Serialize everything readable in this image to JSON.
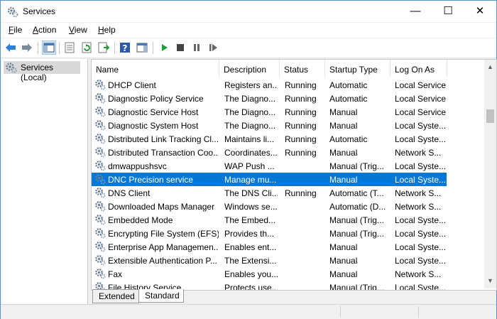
{
  "window": {
    "title": "Services"
  },
  "window_controls": {
    "minimize": "—",
    "maximize": "☐",
    "close": "✕"
  },
  "menu": [
    {
      "label": "File",
      "accel": "F",
      "rest": "ile"
    },
    {
      "label": "Action",
      "accel": "A",
      "rest": "ction"
    },
    {
      "label": "View",
      "accel": "V",
      "rest": "iew"
    },
    {
      "label": "Help",
      "accel": "H",
      "rest": "elp"
    }
  ],
  "toolbar": {
    "icons": [
      "back-arrow-icon",
      "forward-arrow-icon",
      "show-hide-console-tree-icon",
      "properties-icon",
      "refresh-icon",
      "export-list-icon",
      "help-icon",
      "show-hide-action-pane-icon",
      "start-service-icon",
      "stop-service-icon",
      "pause-service-icon",
      "resume-service-icon"
    ]
  },
  "tree": {
    "label": "Services (Local)"
  },
  "table": {
    "columns": [
      "Name",
      "Description",
      "Status",
      "Startup Type",
      "Log On As"
    ],
    "sort_arrow": "^",
    "rows": [
      {
        "name": "DHCP Client",
        "description": "Registers an...",
        "status": "Running",
        "startup": "Automatic",
        "logon": "Local Service"
      },
      {
        "name": "Diagnostic Policy Service",
        "description": "The Diagno...",
        "status": "Running",
        "startup": "Automatic",
        "logon": "Local Service"
      },
      {
        "name": "Diagnostic Service Host",
        "description": "The Diagno...",
        "status": "Running",
        "startup": "Manual",
        "logon": "Local Service"
      },
      {
        "name": "Diagnostic System Host",
        "description": "The Diagno...",
        "status": "Running",
        "startup": "Manual",
        "logon": "Local Syste..."
      },
      {
        "name": "Distributed Link Tracking Cl...",
        "description": "Maintains li...",
        "status": "Running",
        "startup": "Automatic",
        "logon": "Local Syste..."
      },
      {
        "name": "Distributed Transaction Coo...",
        "description": "Coordinates...",
        "status": "Running",
        "startup": "Manual",
        "logon": "Network S..."
      },
      {
        "name": "dmwappushsvc",
        "description": "WAP Push ...",
        "status": "",
        "startup": "Manual (Trig...",
        "logon": "Local Syste..."
      },
      {
        "name": "DNC Precision service",
        "description": "Manage mu...",
        "status": "",
        "startup": "Manual",
        "logon": "Local Syste...",
        "selected": true
      },
      {
        "name": "DNS Client",
        "description": "The DNS Cli...",
        "status": "Running",
        "startup": "Automatic (T...",
        "logon": "Network S..."
      },
      {
        "name": "Downloaded Maps Manager",
        "description": "Windows se...",
        "status": "",
        "startup": "Automatic (D...",
        "logon": "Network S..."
      },
      {
        "name": "Embedded Mode",
        "description": "The Embed...",
        "status": "",
        "startup": "Manual (Trig...",
        "logon": "Local Syste..."
      },
      {
        "name": "Encrypting File System (EFS)",
        "description": "Provides th...",
        "status": "",
        "startup": "Manual (Trig...",
        "logon": "Local Syste..."
      },
      {
        "name": "Enterprise App Managemen...",
        "description": "Enables ent...",
        "status": "",
        "startup": "Manual",
        "logon": "Local Syste..."
      },
      {
        "name": "Extensible Authentication P...",
        "description": "The Extensi...",
        "status": "",
        "startup": "Manual",
        "logon": "Local Syste..."
      },
      {
        "name": "Fax",
        "description": "Enables you...",
        "status": "",
        "startup": "Manual",
        "logon": "Network S..."
      },
      {
        "name": "File History Service",
        "description": "Protects use...",
        "status": "",
        "startup": "Manual (Trig...",
        "logon": "Local Syste..."
      }
    ]
  },
  "tabs": [
    {
      "label": "Extended"
    },
    {
      "label": "Standard",
      "active": true
    }
  ],
  "colors": {
    "selection": "#0078d7",
    "gear": "#6b7f99"
  }
}
